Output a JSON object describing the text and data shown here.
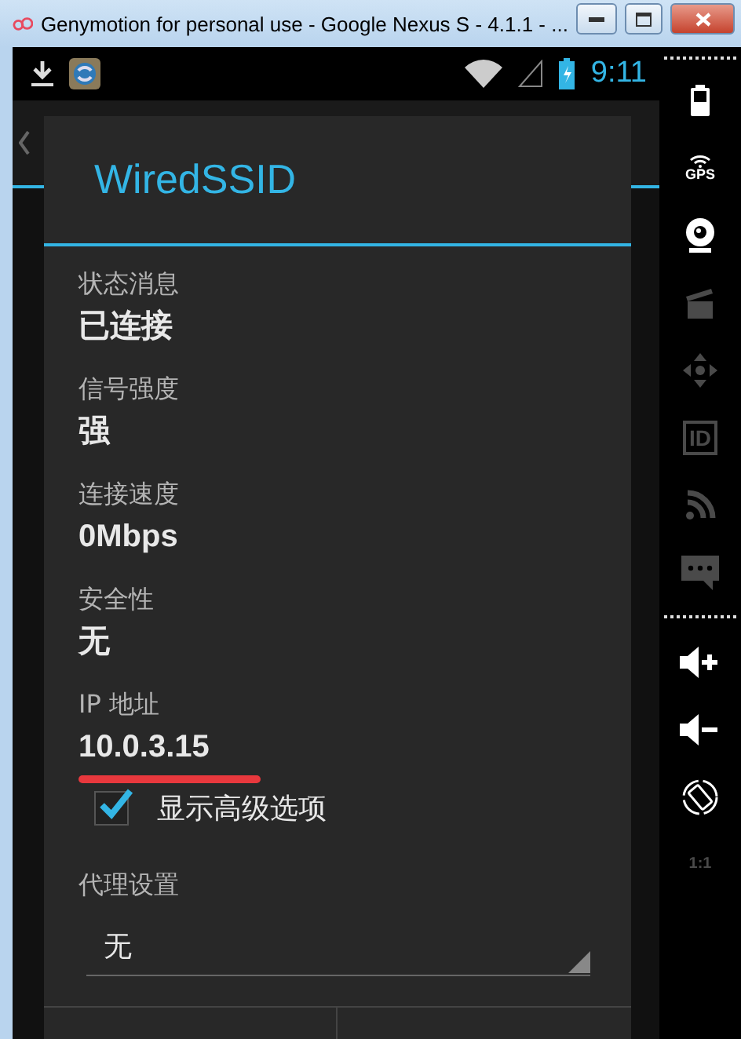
{
  "window": {
    "title": "Genymotion for personal use - Google Nexus S - 4.1.1 - ..."
  },
  "status_bar": {
    "time": "9:11"
  },
  "dialog": {
    "title": "WiredSSID",
    "fields": [
      {
        "label": "状态消息",
        "value": "已连接",
        "highlighted": false
      },
      {
        "label": "信号强度",
        "value": "强",
        "highlighted": false
      },
      {
        "label": "连接速度",
        "value": "0Mbps",
        "highlighted": false
      },
      {
        "label": "安全性",
        "value": "无",
        "highlighted": false
      },
      {
        "label": "IP 地址",
        "value": "10.0.3.15",
        "highlighted": true
      }
    ],
    "advanced_option": {
      "label": "显示高级选项",
      "checked": true
    },
    "proxy": {
      "label": "代理设置",
      "value": "无"
    }
  },
  "sidebar": {
    "tools": [
      {
        "kind": "battery",
        "enabled": true
      },
      {
        "kind": "gps",
        "label": "GPS",
        "enabled": true
      },
      {
        "kind": "camera",
        "enabled": true
      },
      {
        "kind": "clapper",
        "enabled": false
      },
      {
        "kind": "dpad",
        "enabled": false
      },
      {
        "kind": "id",
        "label": "ID",
        "enabled": false
      },
      {
        "kind": "rss",
        "enabled": false
      },
      {
        "kind": "message",
        "enabled": false
      },
      {
        "kind": "separator"
      },
      {
        "kind": "volume_up",
        "enabled": true
      },
      {
        "kind": "volume_down",
        "enabled": true
      },
      {
        "kind": "rotate",
        "enabled": true
      },
      {
        "kind": "scale",
        "label": "1:1",
        "enabled": false
      }
    ]
  }
}
